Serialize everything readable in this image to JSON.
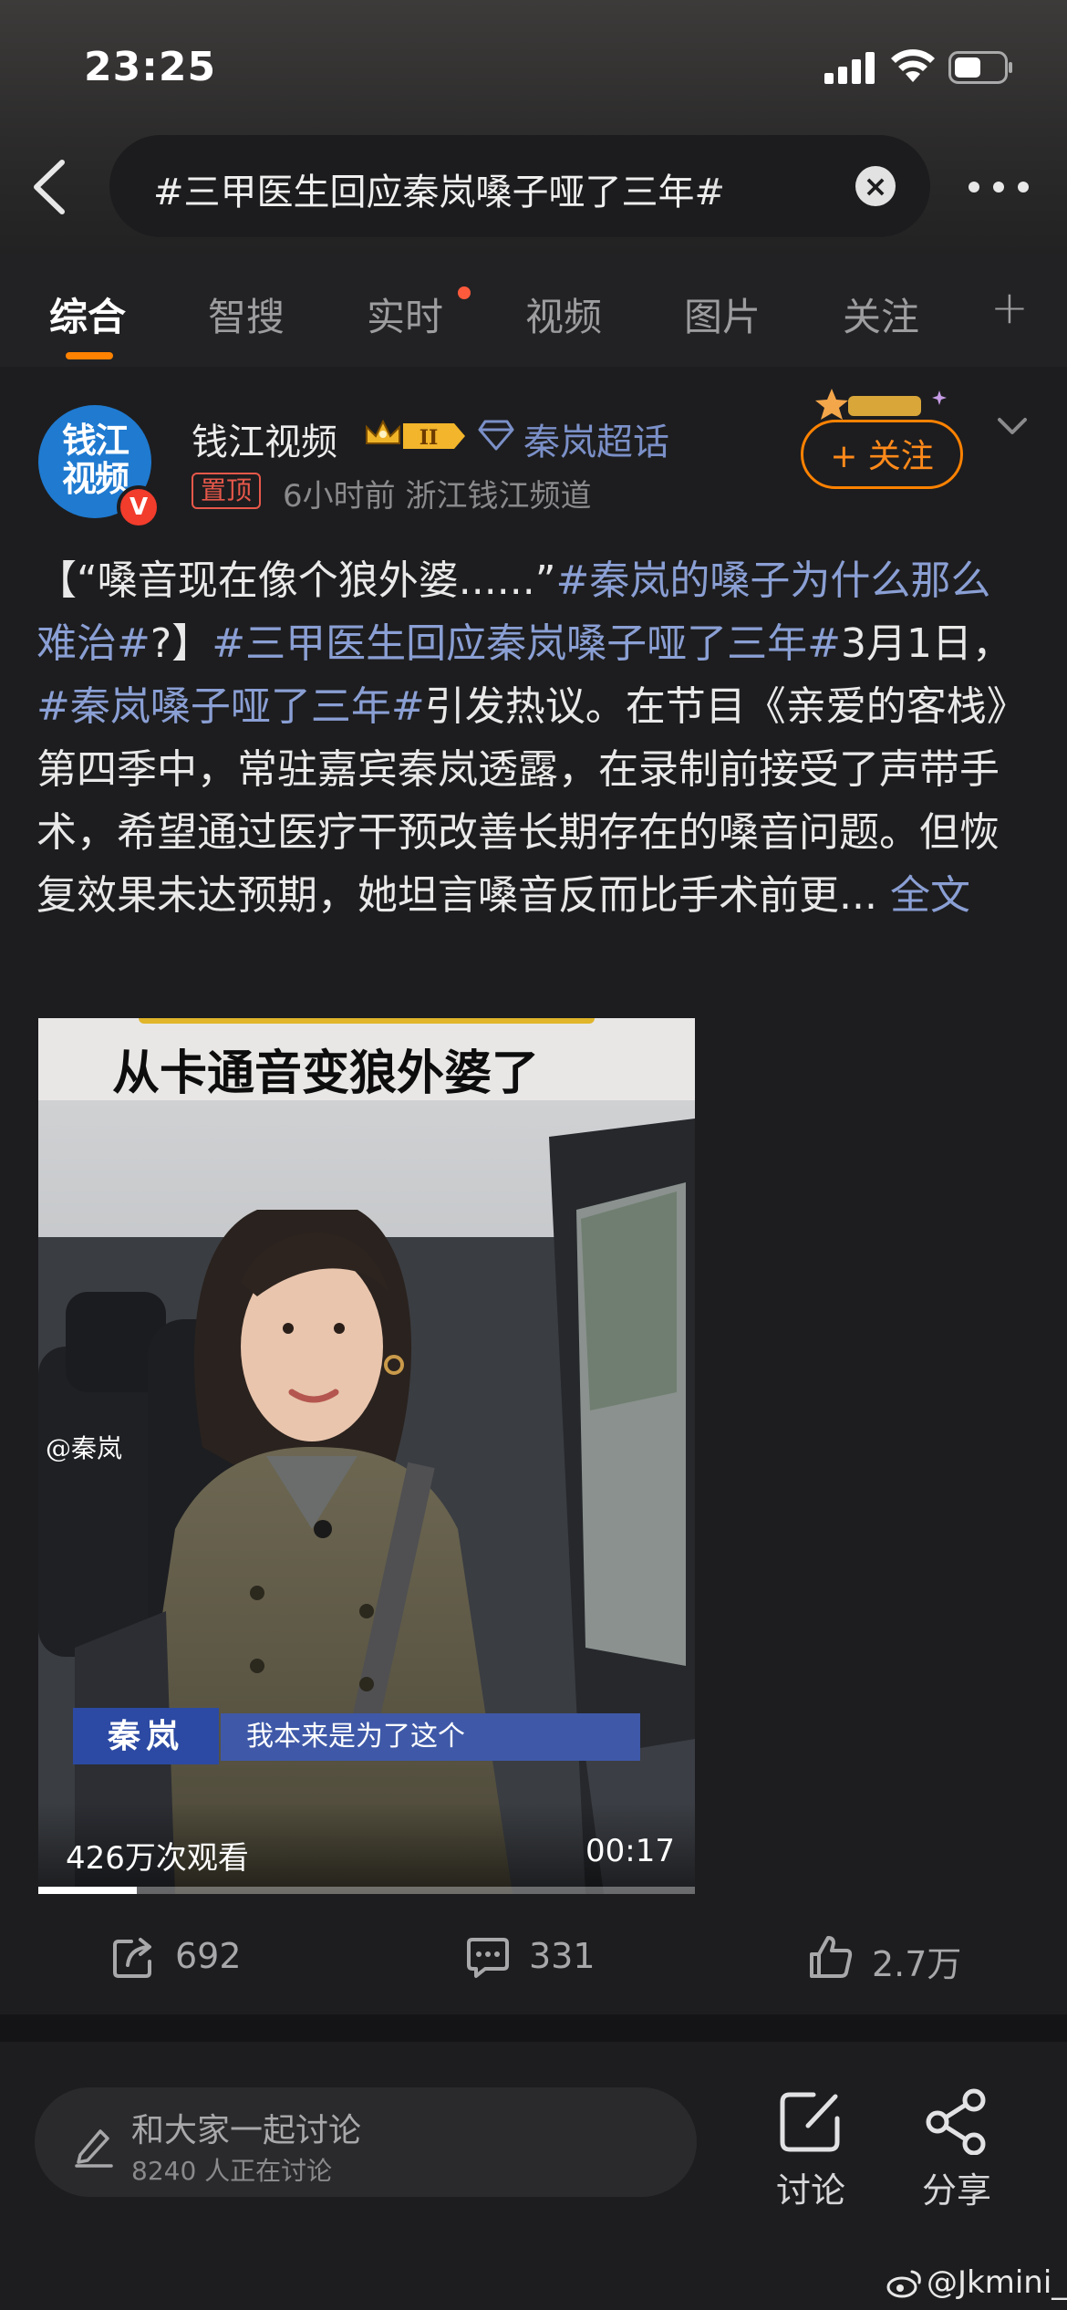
{
  "status_bar": {
    "time": "23:25"
  },
  "search": {
    "query": "#三甲医生回应秦岚嗓子哑了三年#"
  },
  "tabs": [
    {
      "label": "综合",
      "active": true
    },
    {
      "label": "智搜",
      "active": false
    },
    {
      "label": "实时",
      "active": false,
      "dot": true
    },
    {
      "label": "视频",
      "active": false
    },
    {
      "label": "图片",
      "active": false
    },
    {
      "label": "关注",
      "active": false
    }
  ],
  "post": {
    "avatar_text": "钱江视频",
    "author": "钱江视频",
    "level_badge": "II",
    "topic": "秦岚超话",
    "pinned": "置顶",
    "meta": "6小时前  浙江钱江频道",
    "follow_label": "+ 关注",
    "text": {
      "p1": "【“嗓音现在像个狼外婆......”",
      "tag1": "#秦岚的嗓子为什么那么难治#",
      "p2": "?】",
      "tag2": "#三甲医生回应秦岚嗓子哑了三年#",
      "p3": "3月1日，",
      "tag3": "#秦岚嗓子哑了三年#",
      "p4": "引发热议。在节目《亲爱的客栈》第四季中，常驻嘉宾秦岚透露，在录制前接受了声带手术，希望通过医疗干预改善长期存在的嗓音问题。但恢复效果未达预期，她坦言嗓音反而比手术前更...",
      "more": "全文"
    },
    "video": {
      "title": "从卡通音变狼外婆了",
      "watermark": "@秦岚",
      "name_tag": "秦岚",
      "subtitle": "我本来是为了这个",
      "views": "426万次观看",
      "duration": "00:17",
      "progress": 0.15
    },
    "actions": {
      "reposts": "692",
      "comments": "331",
      "likes": "2.7万"
    }
  },
  "bottom": {
    "discuss_title": "和大家一起讨论",
    "discuss_sub": "8240 人正在讨论",
    "discuss_label": "讨论",
    "share_label": "分享"
  },
  "credit": "@Jkmini_",
  "colors": {
    "accent": "#ff8200",
    "link": "#8a9fd4",
    "background": "#1d1d1f"
  }
}
